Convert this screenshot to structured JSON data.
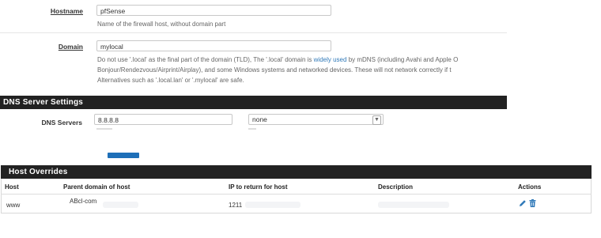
{
  "general": {
    "hostname": {
      "label": "Hostname",
      "value": "pfSense",
      "help": "Name of the firewall host, without domain part"
    },
    "domain": {
      "label": "Domain",
      "value": "mylocal",
      "help_line1_before_link": "Do not use '.local' as the final part of the domain (TLD), The '.local' domain is ",
      "help_link": "widely used",
      "help_line1_after_link": " by mDNS (including Avahi and Apple O",
      "help_line2": "Bonjour/Rendezvous/Airprint/Airplay), and some Windows systems and networked devices. These will not network correctly if t",
      "help_line3": "Alternatives such as '.local.lan' or '.mylocal' are safe."
    }
  },
  "dns_settings": {
    "title": "DNS Server Settings",
    "servers_label": "DNS Servers",
    "server_value": "8.8.8.8",
    "hostname_select": "none"
  },
  "host_overrides": {
    "title": "Host Overrides",
    "columns": [
      "Host",
      "Parent domain of host",
      "IP to return for host",
      "Description",
      "Actions"
    ],
    "rows": [
      {
        "host": "www",
        "domain": "ABcl-com",
        "ip": "1211",
        "description": ""
      }
    ]
  },
  "icons": {
    "edit": "pencil-icon",
    "delete": "trash-icon"
  },
  "colors": {
    "header_bg": "#222222",
    "link": "#317ab9",
    "button": "#1e6fb8"
  }
}
